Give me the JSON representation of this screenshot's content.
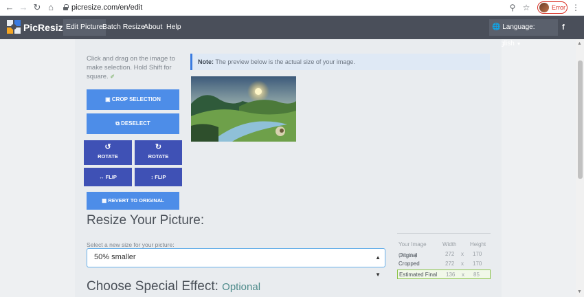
{
  "browser": {
    "url": "picresize.com/en/edit",
    "error_label": "Error"
  },
  "nav": {
    "logo": "PicResize",
    "links": [
      "Edit Picture",
      "Batch Resize",
      "About",
      "Help"
    ],
    "language": "Language: English",
    "facebook": "f"
  },
  "editor": {
    "instructions": "Click and drag on the image to make selection. Hold Shift for square.",
    "note_bold": "Note:",
    "note_text": "The preview below is the actual size of your image.",
    "crop_label": "CROP SELECTION",
    "deselect_label": "DESELECT",
    "rotate_left_label": "ROTATE",
    "rotate_right_label": "ROTATE",
    "flip_h_label": "FLIP",
    "flip_v_label": "FLIP",
    "revert_label": "REVERT TO ORIGINAL"
  },
  "resize": {
    "heading": "Resize Your Picture:",
    "select_label": "Select a new size for your picture:",
    "selected_option": "50% smaller"
  },
  "size_table": {
    "headers": [
      "Your Image",
      "Width",
      "Height"
    ],
    "rows": [
      {
        "label_main": "Original",
        "label_sub": " (Pixels)",
        "width": "272",
        "x": "x",
        "height": "170"
      },
      {
        "label_main": "Cropped",
        "label_sub": "",
        "width": "272",
        "x": "x",
        "height": "170"
      },
      {
        "label_main": "Estimated Final",
        "label_sub": "",
        "width": "136",
        "x": "x",
        "height": "85"
      }
    ]
  },
  "effect": {
    "heading": "Choose Special Effect:",
    "optional": "Optional"
  },
  "colors": {
    "button_blue": "#4d8de8",
    "button_indigo": "#3f51b5",
    "navbar": "#4a4f5a"
  }
}
